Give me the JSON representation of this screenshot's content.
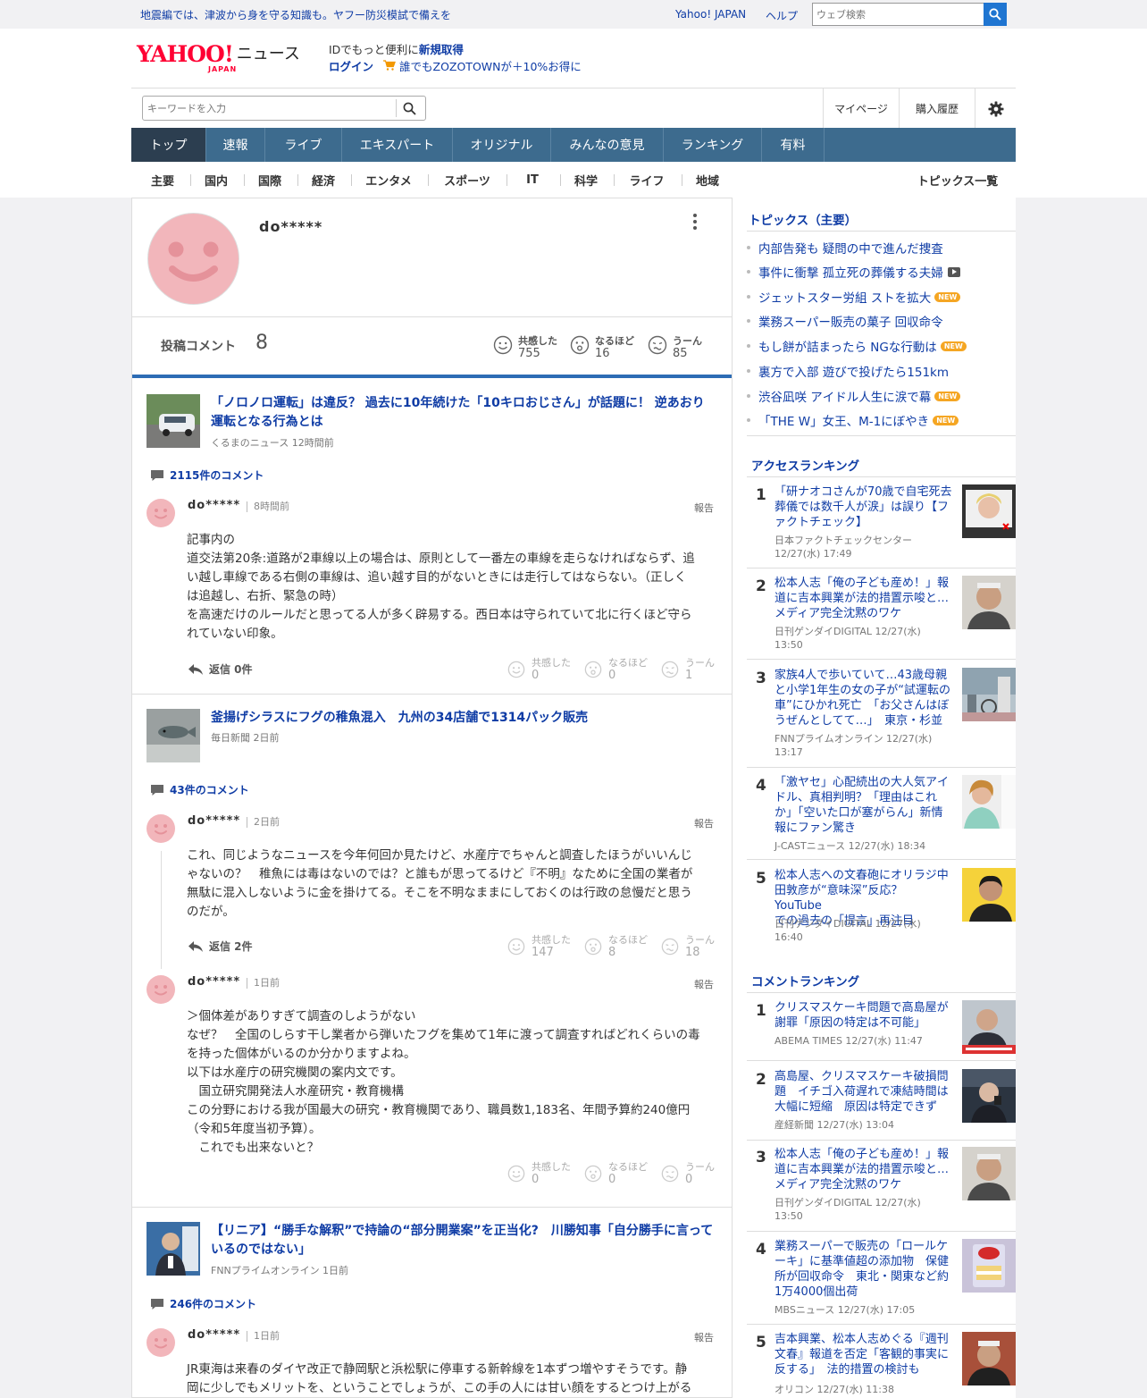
{
  "topbar": {
    "promo": "地震編では、津波から身を守る知識も。ヤフー防災模試で備えを",
    "yahoo_japan": "Yahoo! JAPAN",
    "help": "ヘルプ",
    "web_search_placeholder": "ウェブ検索"
  },
  "masthead": {
    "logo_text": "YAHOO!",
    "logo_sub": "JAPAN",
    "logo_news": "ニュース",
    "id_line_pre": "IDでもっと便利に",
    "id_line_link": "新規取得",
    "login": "ログイン",
    "zozo": "誰でもZOZOTOWNが＋10%お得に"
  },
  "search": {
    "placeholder": "キーワードを入力",
    "mypage": "マイページ",
    "history": "購入履歴"
  },
  "main_nav": [
    "トップ",
    "速報",
    "ライブ",
    "エキスパート",
    "オリジナル",
    "みんなの意見",
    "ランキング",
    "有料"
  ],
  "sub_nav": [
    "主要",
    "国内",
    "国際",
    "経済",
    "エンタメ",
    "スポーツ",
    "IT",
    "科学",
    "ライフ",
    "地域"
  ],
  "sub_nav_all": "トピックス一覧",
  "profile": {
    "username": "do*****",
    "stat_label": "投稿コメント",
    "stat_count": "8",
    "reactions": [
      {
        "label": "共感した",
        "count": "755"
      },
      {
        "label": "なるほど",
        "count": "16"
      },
      {
        "label": "うーん",
        "count": "85"
      }
    ]
  },
  "articles": [
    {
      "title": "「ノロノロ運転」は違反？ 過去に10年続けた「10キロおじさん」が話題に！ 逆あおり運転となる行為とは",
      "source": "くるまのニュース 12時間前",
      "comment_count": "2115件のコメント",
      "comments": [
        {
          "user": "do*****",
          "time": "8時間前",
          "report": "報告",
          "lines": [
            "記事内の",
            "道交法第20条:道路が2車線以上の場合は、原則として一番左の車線を走らなければならず、追",
            "い越し車線である右側の車線は、追い越す目的がないときには走行してはならない。（正しく",
            "は追越し、右折、緊急の時）",
            "を高速だけのルールだと思ってる人が多く辟易する。西日本は守られていて北に行くほど守ら",
            "れていない印象。"
          ],
          "reply": "返信 0件",
          "reactions": [
            {
              "label": "共感した",
              "count": "0"
            },
            {
              "label": "なるほど",
              "count": "0"
            },
            {
              "label": "うーん",
              "count": "1"
            }
          ]
        }
      ]
    },
    {
      "title": "釜揚げシラスにフグの稚魚混入　九州の34店舗で1314パック販売",
      "source": "毎日新聞 2日前",
      "comment_count": "43件のコメント",
      "comments": [
        {
          "user": "do*****",
          "time": "2日前",
          "report": "報告",
          "lines": [
            "これ、同じようなニュースを今年何回か見たけど、水産庁でちゃんと調査したほうがいいんじ",
            "ゃないの？　稚魚には毒はないのでは？と誰もが思ってるけど『不明』なために全国の業者が",
            "無駄に混入しないように金を掛けてる。そこを不明なままにしておくのは行政の怠慢だと思う",
            "のだが。"
          ],
          "reply": "返信 2件",
          "reactions": [
            {
              "label": "共感した",
              "count": "147"
            },
            {
              "label": "なるほど",
              "count": "8"
            },
            {
              "label": "うーん",
              "count": "18"
            }
          ]
        },
        {
          "user": "do*****",
          "time": "1日前",
          "report": "報告",
          "lines": [
            "＞個体差がありすぎて調査のしようがない",
            "なぜ？　全国のしらす干し業者から弾いたフグを集めて1年に渡って調査すればどれくらいの毒",
            "を持った個体がいるのか分かりますよね。",
            "以下は水産庁の研究機関の案内文です。",
            "　国立研究開発法人水産研究・教育機構",
            "この分野における我が国最大の研究・教育機関であり、職員数1,183名、年間予算約240億円",
            "（令和5年度当初予算）。",
            "　これでも出来ないと？"
          ],
          "reactions": [
            {
              "label": "共感した",
              "count": "0"
            },
            {
              "label": "なるほど",
              "count": "0"
            },
            {
              "label": "うーん",
              "count": "0"
            }
          ]
        }
      ]
    },
    {
      "title": "【リニア】“勝手な解釈”で持論の“部分開業案”を正当化?　川勝知事「自分勝手に言っているのではない」",
      "source": "FNNプライムオンライン 1日前",
      "comment_count": "246件のコメント",
      "comments": [
        {
          "user": "do*****",
          "time": "1日前",
          "report": "報告",
          "lines": [
            "JR東海は来春のダイヤ改正で静岡駅と浜松駅に停車する新幹線を1本ずつ増やすそうです。静",
            "岡に少しでもメリットを、ということでしょうが、この手の人には甘い顔をするとつけ上がる"
          ]
        }
      ]
    }
  ],
  "sidebar": {
    "topics_title": "トピックス（主要）",
    "topics": [
      {
        "text": "内部告発も 疑問の中で進んだ捜査",
        "badge": ""
      },
      {
        "text": "事件に衝撃 孤立死の葬儀する夫婦",
        "badge": "video"
      },
      {
        "text": "ジェットスター労組 ストを拡大",
        "badge": "NEW"
      },
      {
        "text": "業務スーパー販売の菓子 回収命令",
        "badge": ""
      },
      {
        "text": "もし餅が詰まったら NGな行動は",
        "badge": "NEW"
      },
      {
        "text": "裏方で入部 遊びで投げたら151km",
        "badge": ""
      },
      {
        "text": "渋谷凪咲 アイドル人生に涙で幕",
        "badge": "NEW"
      },
      {
        "text": "「THE W」女王、M-1にぼやき",
        "badge": "NEW"
      }
    ],
    "access_title": "アクセスランキング",
    "access": [
      {
        "rank": "1",
        "lines": [
          "「研ナオコさんが70歳で自宅死去",
          "葬儀では数千人が涙」は誤り【フ",
          "ァクトチェック】"
        ],
        "src": [
          "日本ファクトチェックセンター",
          "12/27(水) 17:49"
        ]
      },
      {
        "rank": "2",
        "lines": [
          "松本人志「俺の子ども産め！」報",
          "道に吉本興業が法的措置示唆と…",
          "メディア完全沈黙のワケ"
        ],
        "src": [
          "日刊ゲンダイDIGITAL 12/27(水)",
          "13:50"
        ]
      },
      {
        "rank": "3",
        "lines": [
          "家族4人で歩いていて…43歳母親",
          "と小学1年生の女の子が“試運転の",
          "車”にひかれ死亡　「お父さんはぼ",
          "うぜんとしてて…」　東京・杉並"
        ],
        "src": [
          "FNNプライムオンライン 12/27(水)",
          "13:17"
        ]
      },
      {
        "rank": "4",
        "lines": [
          "「激ヤセ」心配続出の大人気アイ",
          "ドル、真相判明？「理由はこれ",
          "か」「空いた口が塞がらん」新情",
          "報にファン驚き"
        ],
        "src": [
          "J-CASTニュース 12/27(水) 18:34"
        ]
      },
      {
        "rank": "5",
        "lines": [
          "松本人志への文春砲にオリラジ中",
          "田敦彦が“意味深”反応？ YouTube",
          "での過去の「提言」再注目"
        ],
        "src": [
          "日刊ゲンダイDIGITAL 12/27(水)",
          "16:40"
        ]
      }
    ],
    "comment_title": "コメントランキング",
    "comment_rank": [
      {
        "rank": "1",
        "lines": [
          "クリスマスケーキ問題で高島屋が",
          "謝罪「原因の特定は不可能」"
        ],
        "src": [
          "ABEMA TIMES 12/27(水) 11:47"
        ]
      },
      {
        "rank": "2",
        "lines": [
          "高島屋、クリスマスケーキ破損問",
          "題　イチゴ入荷遅れで凍結時間は",
          "大幅に短縮　原因は特定できず"
        ],
        "src": [
          "産経新聞 12/27(水) 13:04"
        ]
      },
      {
        "rank": "3",
        "lines": [
          "松本人志「俺の子ども産め！」報",
          "道に吉本興業が法的措置示唆と…",
          "メディア完全沈黙のワケ"
        ],
        "src": [
          "日刊ゲンダイDIGITAL 12/27(水)",
          "13:50"
        ]
      },
      {
        "rank": "4",
        "lines": [
          "業務スーパーで販売の「ロールケ",
          "ーキ」に基準値超の添加物　保健",
          "所が回収命令　東北・関東など約",
          "1万4000個出荷"
        ],
        "src": [
          "MBSニュース 12/27(水) 17:05"
        ]
      },
      {
        "rank": "5",
        "lines": [
          "吉本興業、松本人志めぐる『週刊",
          "文春』報道を否定「客観的事実に",
          "反する」　法的措置の検討も"
        ],
        "src": [
          "オリコン 12/27(水) 11:38"
        ]
      }
    ]
  }
}
